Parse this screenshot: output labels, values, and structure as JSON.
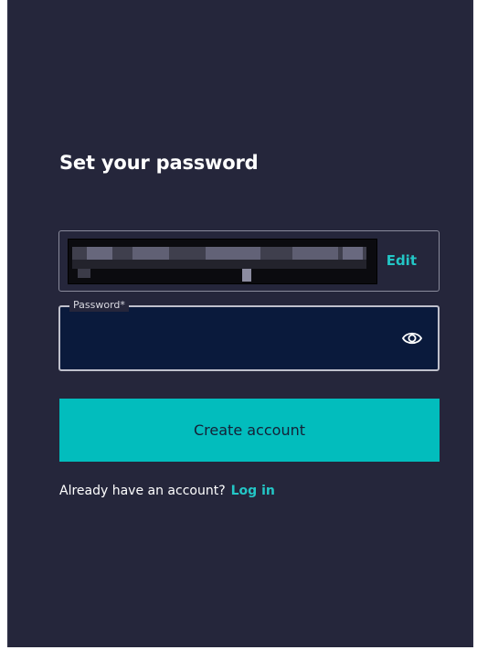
{
  "form": {
    "title": "Set your password",
    "email_edit_label": "Edit",
    "password_label": "Password*",
    "password_value": "",
    "password_toggle_icon": "eye-icon",
    "submit_label": "Create account",
    "login_prompt": "Already have an account?",
    "login_link": "Log in"
  },
  "colors": {
    "background": "#25263b",
    "accent": "#02bdbd",
    "link": "#23c6c6",
    "input_fill": "#0a1a3c"
  }
}
